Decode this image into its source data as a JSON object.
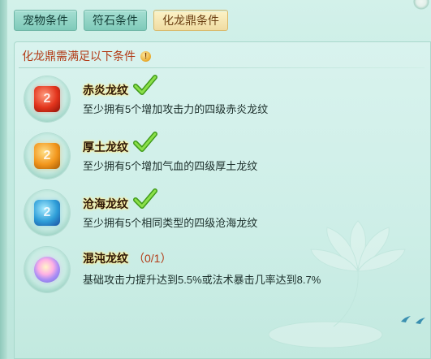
{
  "tabs": [
    {
      "label": "宠物条件",
      "active": false
    },
    {
      "label": "符石条件",
      "active": false
    },
    {
      "label": "化龙鼎条件",
      "active": true
    }
  ],
  "panel": {
    "header": "化龙鼎需满足以下条件",
    "info_icon": "!"
  },
  "conditions": [
    {
      "title": "赤炎龙纹",
      "desc": "至少拥有5个增加攻击力的四级赤炎龙纹",
      "completed": true,
      "gem": "red-gem-icon",
      "glyph": "2"
    },
    {
      "title": "厚土龙纹",
      "desc": "至少拥有5个增加气血的四级厚土龙纹",
      "completed": true,
      "gem": "amber-gem-icon",
      "glyph": "2"
    },
    {
      "title": "沧海龙纹",
      "desc": "至少拥有5个相同类型的四级沧海龙纹",
      "completed": true,
      "gem": "blue-gem-icon",
      "glyph": "2"
    },
    {
      "title": "混沌龙纹",
      "progress": "（0/1）",
      "desc": "基础攻击力提升达到5.5%或法术暴击几率达到8.7%",
      "completed": false,
      "gem": "purple-gem-icon",
      "glyph": ""
    }
  ],
  "colors": {
    "accent_red": "#b23a16",
    "check_green": "#5fbf2a",
    "active_tab": "#f0dca2"
  }
}
